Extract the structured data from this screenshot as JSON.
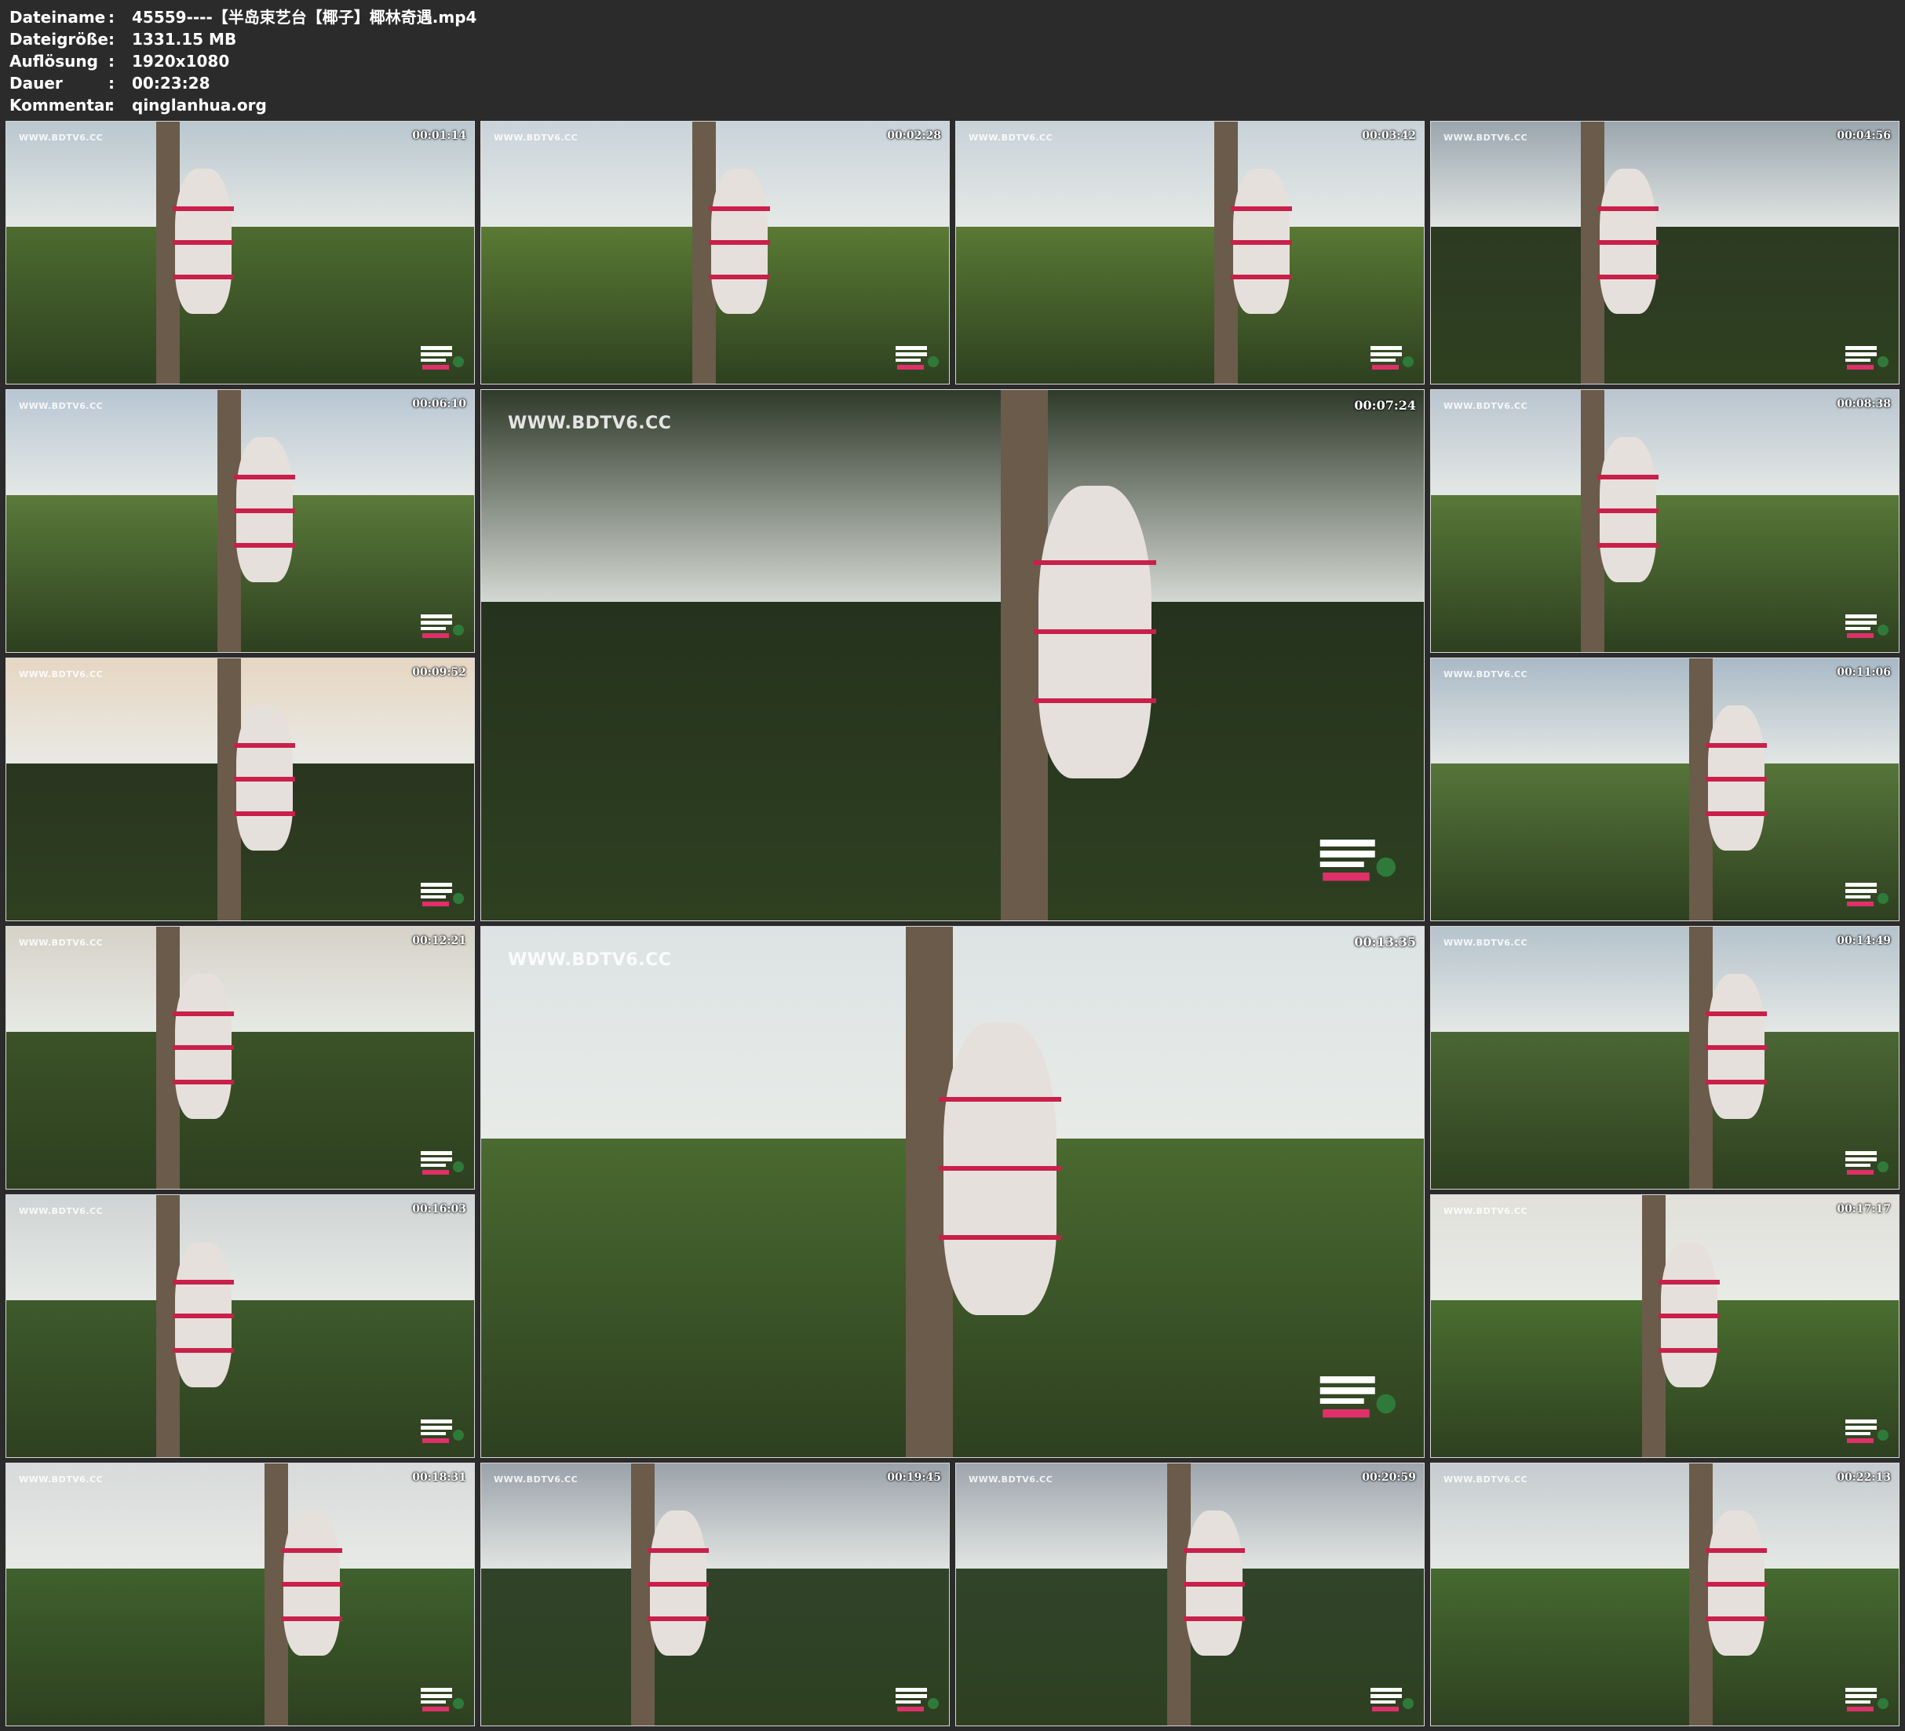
{
  "info": {
    "rows": [
      {
        "key": "Dateiname",
        "value": "45559----【半岛束艺台【椰子】椰林奇遇.mp4"
      },
      {
        "key": "Dateigröße",
        "value": "1331.15 MB"
      },
      {
        "key": "Auflösung",
        "value": "1920x1080"
      },
      {
        "key": "Dauer",
        "value": "00:23:28"
      },
      {
        "key": "Kommentar",
        "value": "qinglanhua.org"
      }
    ],
    "separator": ":"
  },
  "watermark": "WWW.BDTV6.CC",
  "colors": {
    "background": "#2b2b2b",
    "rope": "#c8204a",
    "foliage": "#3f5a2a"
  },
  "thumbnails": [
    {
      "timestamp": "00:01:14"
    },
    {
      "timestamp": "00:02:28"
    },
    {
      "timestamp": "00:03:42"
    },
    {
      "timestamp": "00:04:56"
    },
    {
      "timestamp": "00:06:10"
    },
    {
      "timestamp": "00:07:24"
    },
    {
      "timestamp": "00:08:38"
    },
    {
      "timestamp": "00:09:52"
    },
    {
      "timestamp": "00:11:06"
    },
    {
      "timestamp": "00:12:21"
    },
    {
      "timestamp": "00:13:35"
    },
    {
      "timestamp": "00:14:49"
    },
    {
      "timestamp": "00:16:03"
    },
    {
      "timestamp": "00:17:17"
    },
    {
      "timestamp": "00:18:31"
    },
    {
      "timestamp": "00:19:45"
    },
    {
      "timestamp": "00:20:59"
    },
    {
      "timestamp": "00:22:13"
    }
  ]
}
